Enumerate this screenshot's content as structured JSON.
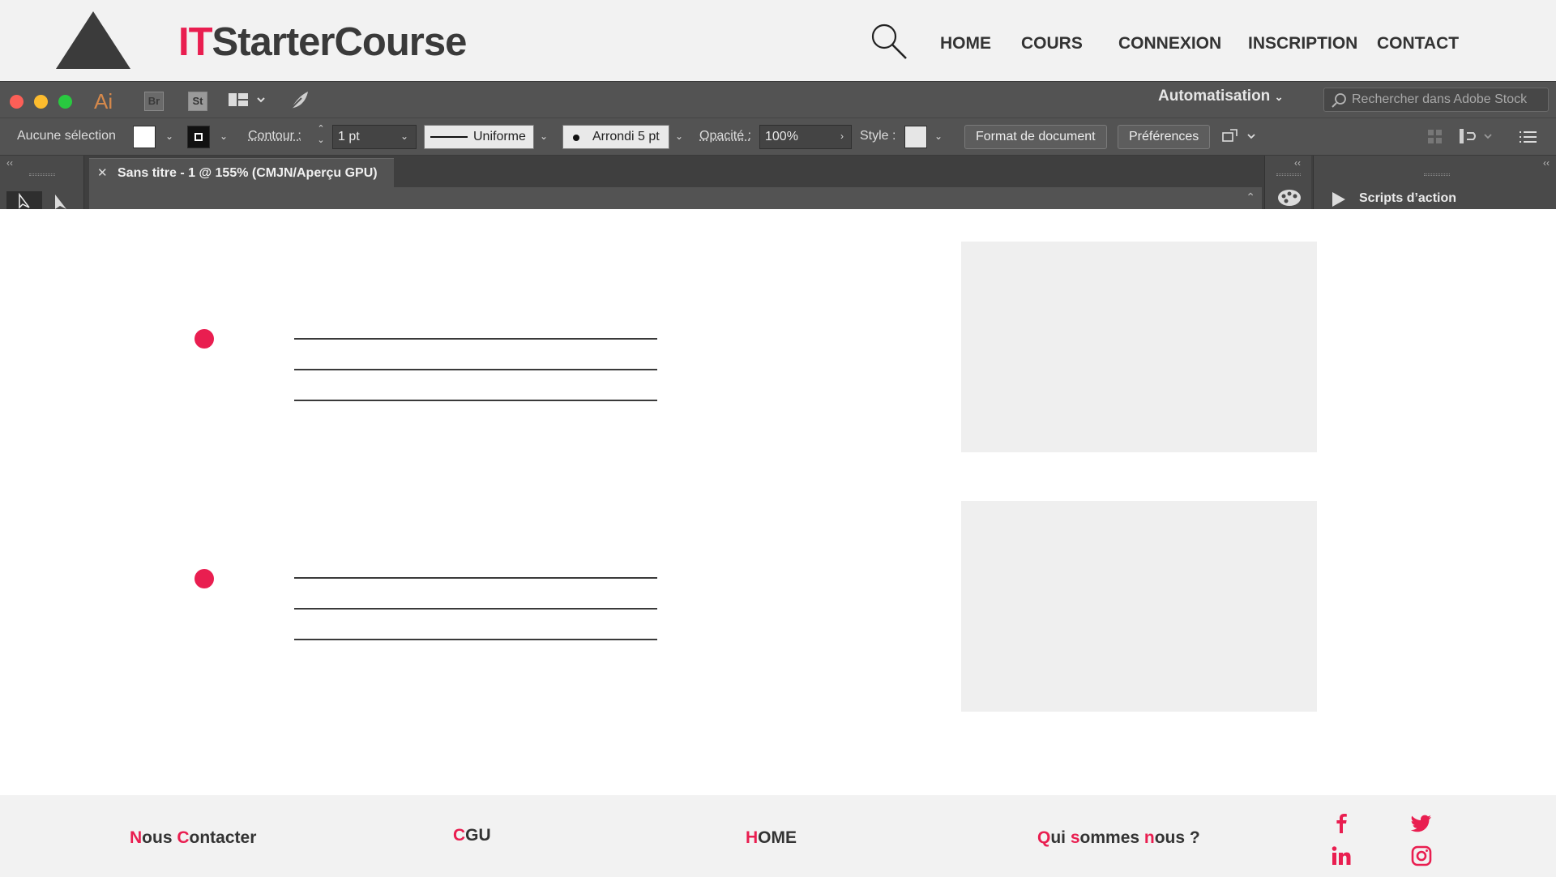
{
  "site": {
    "brand_accent": "IT",
    "brand_rest": "StarterCourse",
    "nav": [
      "HOME",
      "COURS",
      "CONNEXION",
      "INSCRIPTION",
      "CONTACT"
    ]
  },
  "illustrator": {
    "app_badges": [
      "Ai",
      "Br",
      "St"
    ],
    "workspace": "Automatisation",
    "stock_search_placeholder": "Rechercher dans Adobe Stock",
    "control": {
      "selection": "Aucune sélection",
      "stroke_label": "Contour :",
      "stroke_weight": "1 pt",
      "stroke_profile": "Uniforme",
      "brush": "Arrondi 5 pt",
      "opacity_label": "Opacité :",
      "opacity": "100%",
      "style_label": "Style :",
      "document_setup_button": "Format de document",
      "preferences_button": "Préférences"
    },
    "document_tab": "Sans titre - 1 @ 155% (CMJN/Aperçu GPU)",
    "panel_title": "Scripts d’action"
  },
  "footer": {
    "links": [
      {
        "parts": [
          {
            "t": "N",
            "c": 1
          },
          {
            "t": "ous ",
            "c": 0
          },
          {
            "t": "C",
            "c": 1
          },
          {
            "t": "ontacter",
            "c": 0
          }
        ]
      },
      {
        "parts": [
          {
            "t": "C",
            "c": 1
          },
          {
            "t": "GU",
            "c": 0
          }
        ]
      },
      {
        "parts": [
          {
            "t": "H",
            "c": 1
          },
          {
            "t": "OME",
            "c": 0
          }
        ]
      },
      {
        "parts": [
          {
            "t": "Q",
            "c": 1
          },
          {
            "t": "ui ",
            "c": 0
          },
          {
            "t": "s",
            "c": 1
          },
          {
            "t": "ommes ",
            "c": 0
          },
          {
            "t": "n",
            "c": 1
          },
          {
            "t": "ous ?",
            "c": 0
          }
        ]
      }
    ],
    "social_icons": [
      "facebook-icon",
      "twitter-icon",
      "linkedin-icon",
      "instagram-icon"
    ]
  },
  "colors": {
    "accent": "#e91e50",
    "header_bg": "#f2f2f2",
    "ai_chrome": "#535353",
    "placeholder": "#efefef"
  }
}
